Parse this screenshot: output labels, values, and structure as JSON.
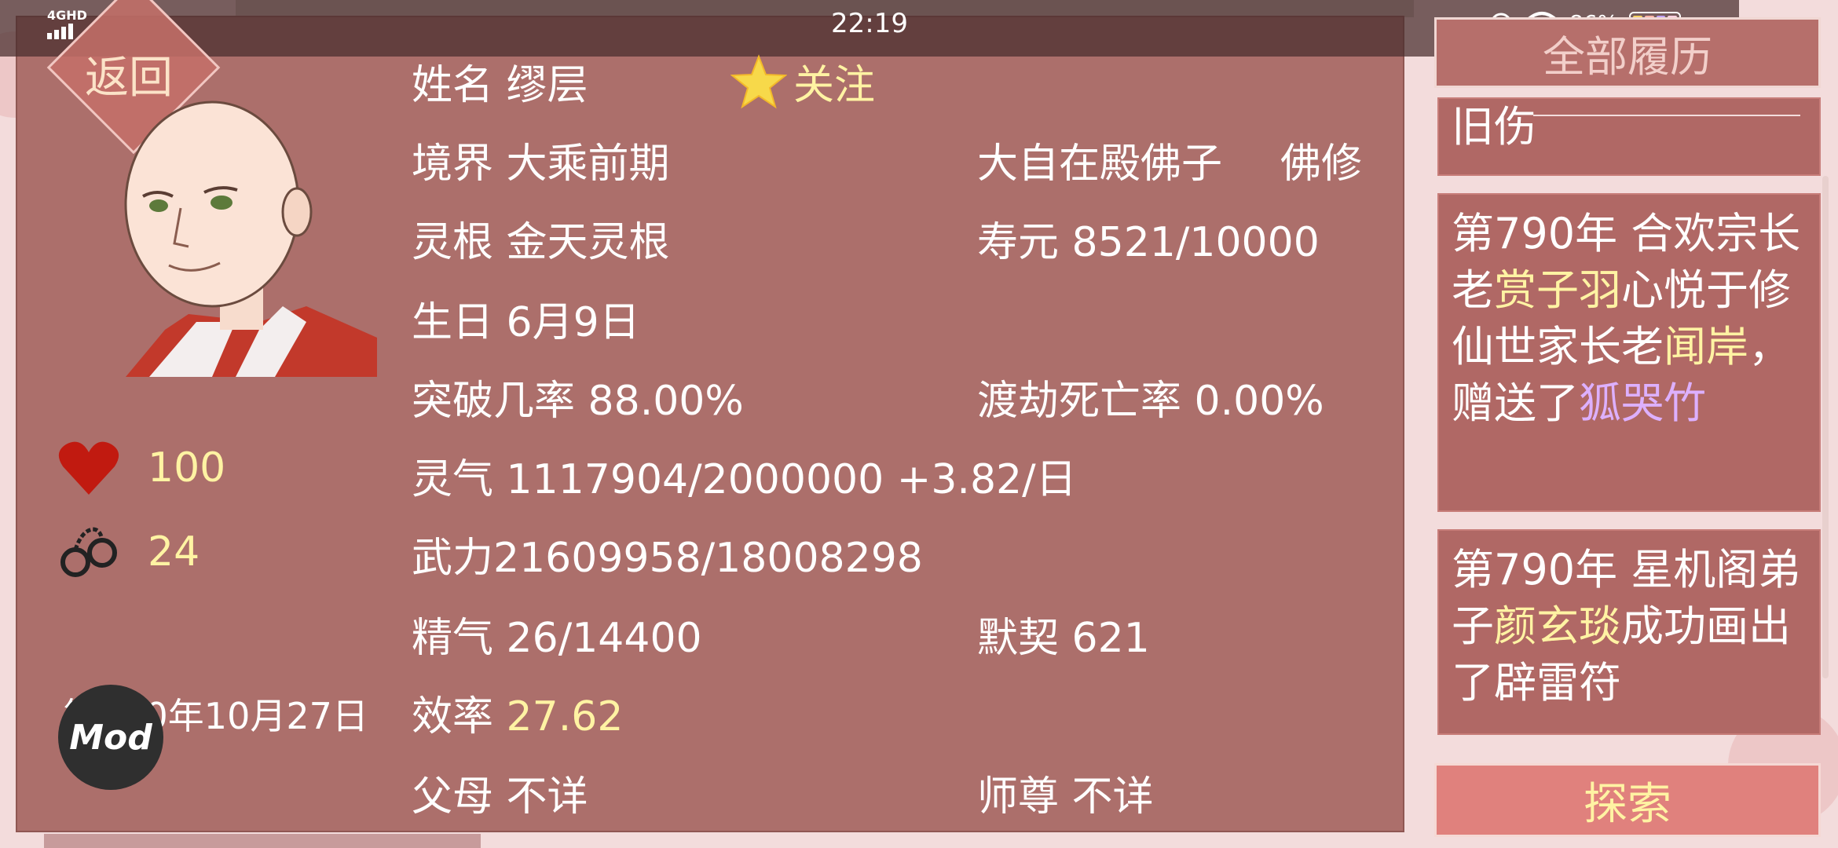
{
  "status_bar": {
    "time": "22:19",
    "network": "4GHD",
    "battery_percent": "86%",
    "battery_colors": [
      "#f6d365",
      "#ffb3a7",
      "#c2a3ff",
      "#ffd0e0"
    ]
  },
  "profile": {
    "back_label": "返回",
    "follow_label": "关注",
    "health": "100",
    "bonds": "24",
    "date": "第790年10月27日",
    "mod_label": "Mod"
  },
  "info": {
    "name": "姓名 缪层",
    "realm": "境界 大乘前期",
    "identity": "大自在殿佛子",
    "school": "佛修",
    "root": "灵根 金天灵根",
    "lifespan": "寿元 8521/10000",
    "birthday": "生日 6月9日",
    "breakthrough": "突破几率 88.00%",
    "tribulation": "渡劫死亡率 0.00%",
    "qi": "灵气 1117904/2000000 +3.82/日",
    "force": "武力21609958/18008298",
    "essence": "精气 26/14400",
    "tacit": "默契 621",
    "efficiency_label": "效率",
    "efficiency_value": "27.62",
    "parents": "父母 不详",
    "master": "师尊 不详"
  },
  "history": {
    "tab_label": "全部履历",
    "card0": "旧伤",
    "card1": {
      "p1": "第790年 合欢宗长老",
      "name1": "赏子羽",
      "p2": "心悦于修仙世家长老",
      "name2": "闻岸",
      "p3": "，赠送了",
      "item": "狐哭竹"
    },
    "card2": {
      "p1": "第790年 星机阁弟子",
      "name1": "颜玄琰",
      "p2": "成功画出了辟雷符"
    },
    "explore_label": "探索"
  }
}
